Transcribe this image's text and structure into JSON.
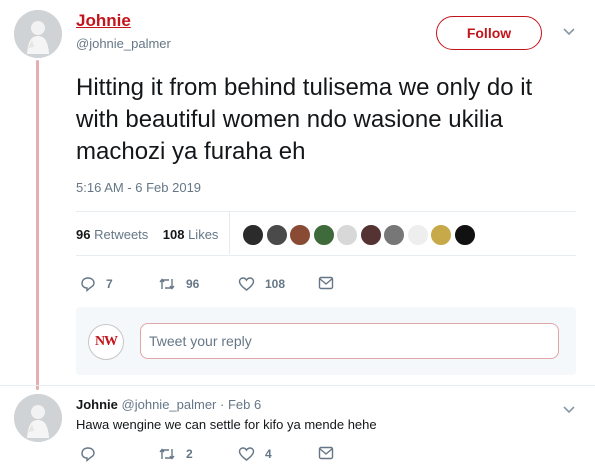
{
  "main_tweet": {
    "author_name": "Johnie",
    "author_handle": "@johnie_palmer",
    "follow_label": "Follow",
    "text": "Hitting it from behind tulisema we only do it with beautiful women ndo wasione ukilia machozi ya furaha eh",
    "timestamp": "5:16 AM - 6 Feb 2019",
    "retweets_count": "96",
    "retweets_label": "Retweets",
    "likes_count": "108",
    "likes_label": "Likes",
    "actions": {
      "reply_count": "7",
      "retweet_count": "96",
      "like_count": "108"
    }
  },
  "liker_avatars": [
    "#2b2b2b",
    "#4a4a4a",
    "#8a4b35",
    "#3f6b3a",
    "#d8d8d8",
    "#553333",
    "#777777",
    "#eeeeee",
    "#c8a94a",
    "#111111"
  ],
  "reply_composer": {
    "logo_text": "NW",
    "placeholder": "Tweet your reply"
  },
  "reply_tweet": {
    "author_name": "Johnie",
    "author_handle": "@johnie_palmer",
    "date": "· Feb 6",
    "text": "Hawa wengine we can settle for kifo ya mende hehe",
    "actions": {
      "retweet_count": "2",
      "like_count": "4"
    }
  },
  "colors": {
    "brand": "#c4141b",
    "muted": "#657786",
    "thread_line": "#e3aeb0"
  }
}
